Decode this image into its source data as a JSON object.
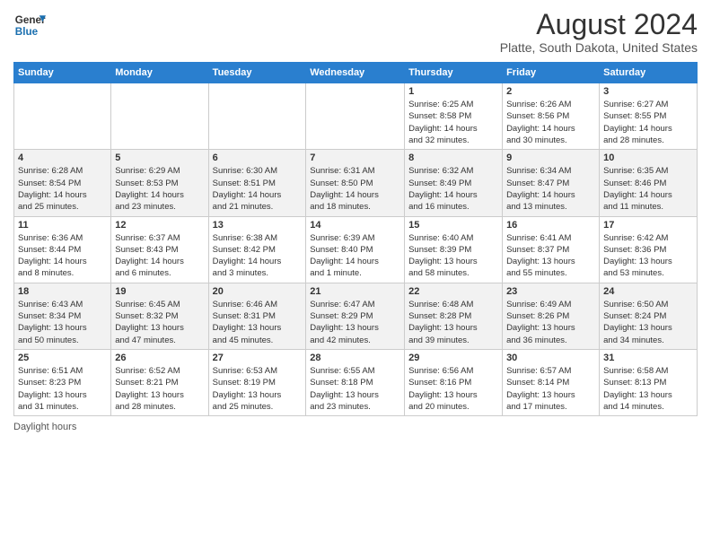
{
  "header": {
    "logo_line1": "General",
    "logo_line2": "Blue",
    "title": "August 2024",
    "subtitle": "Platte, South Dakota, United States"
  },
  "calendar": {
    "days_of_week": [
      "Sunday",
      "Monday",
      "Tuesday",
      "Wednesday",
      "Thursday",
      "Friday",
      "Saturday"
    ],
    "weeks": [
      [
        {
          "day": "",
          "info": ""
        },
        {
          "day": "",
          "info": ""
        },
        {
          "day": "",
          "info": ""
        },
        {
          "day": "",
          "info": ""
        },
        {
          "day": "1",
          "info": "Sunrise: 6:25 AM\nSunset: 8:58 PM\nDaylight: 14 hours\nand 32 minutes."
        },
        {
          "day": "2",
          "info": "Sunrise: 6:26 AM\nSunset: 8:56 PM\nDaylight: 14 hours\nand 30 minutes."
        },
        {
          "day": "3",
          "info": "Sunrise: 6:27 AM\nSunset: 8:55 PM\nDaylight: 14 hours\nand 28 minutes."
        }
      ],
      [
        {
          "day": "4",
          "info": "Sunrise: 6:28 AM\nSunset: 8:54 PM\nDaylight: 14 hours\nand 25 minutes."
        },
        {
          "day": "5",
          "info": "Sunrise: 6:29 AM\nSunset: 8:53 PM\nDaylight: 14 hours\nand 23 minutes."
        },
        {
          "day": "6",
          "info": "Sunrise: 6:30 AM\nSunset: 8:51 PM\nDaylight: 14 hours\nand 21 minutes."
        },
        {
          "day": "7",
          "info": "Sunrise: 6:31 AM\nSunset: 8:50 PM\nDaylight: 14 hours\nand 18 minutes."
        },
        {
          "day": "8",
          "info": "Sunrise: 6:32 AM\nSunset: 8:49 PM\nDaylight: 14 hours\nand 16 minutes."
        },
        {
          "day": "9",
          "info": "Sunrise: 6:34 AM\nSunset: 8:47 PM\nDaylight: 14 hours\nand 13 minutes."
        },
        {
          "day": "10",
          "info": "Sunrise: 6:35 AM\nSunset: 8:46 PM\nDaylight: 14 hours\nand 11 minutes."
        }
      ],
      [
        {
          "day": "11",
          "info": "Sunrise: 6:36 AM\nSunset: 8:44 PM\nDaylight: 14 hours\nand 8 minutes."
        },
        {
          "day": "12",
          "info": "Sunrise: 6:37 AM\nSunset: 8:43 PM\nDaylight: 14 hours\nand 6 minutes."
        },
        {
          "day": "13",
          "info": "Sunrise: 6:38 AM\nSunset: 8:42 PM\nDaylight: 14 hours\nand 3 minutes."
        },
        {
          "day": "14",
          "info": "Sunrise: 6:39 AM\nSunset: 8:40 PM\nDaylight: 14 hours\nand 1 minute."
        },
        {
          "day": "15",
          "info": "Sunrise: 6:40 AM\nSunset: 8:39 PM\nDaylight: 13 hours\nand 58 minutes."
        },
        {
          "day": "16",
          "info": "Sunrise: 6:41 AM\nSunset: 8:37 PM\nDaylight: 13 hours\nand 55 minutes."
        },
        {
          "day": "17",
          "info": "Sunrise: 6:42 AM\nSunset: 8:36 PM\nDaylight: 13 hours\nand 53 minutes."
        }
      ],
      [
        {
          "day": "18",
          "info": "Sunrise: 6:43 AM\nSunset: 8:34 PM\nDaylight: 13 hours\nand 50 minutes."
        },
        {
          "day": "19",
          "info": "Sunrise: 6:45 AM\nSunset: 8:32 PM\nDaylight: 13 hours\nand 47 minutes."
        },
        {
          "day": "20",
          "info": "Sunrise: 6:46 AM\nSunset: 8:31 PM\nDaylight: 13 hours\nand 45 minutes."
        },
        {
          "day": "21",
          "info": "Sunrise: 6:47 AM\nSunset: 8:29 PM\nDaylight: 13 hours\nand 42 minutes."
        },
        {
          "day": "22",
          "info": "Sunrise: 6:48 AM\nSunset: 8:28 PM\nDaylight: 13 hours\nand 39 minutes."
        },
        {
          "day": "23",
          "info": "Sunrise: 6:49 AM\nSunset: 8:26 PM\nDaylight: 13 hours\nand 36 minutes."
        },
        {
          "day": "24",
          "info": "Sunrise: 6:50 AM\nSunset: 8:24 PM\nDaylight: 13 hours\nand 34 minutes."
        }
      ],
      [
        {
          "day": "25",
          "info": "Sunrise: 6:51 AM\nSunset: 8:23 PM\nDaylight: 13 hours\nand 31 minutes."
        },
        {
          "day": "26",
          "info": "Sunrise: 6:52 AM\nSunset: 8:21 PM\nDaylight: 13 hours\nand 28 minutes."
        },
        {
          "day": "27",
          "info": "Sunrise: 6:53 AM\nSunset: 8:19 PM\nDaylight: 13 hours\nand 25 minutes."
        },
        {
          "day": "28",
          "info": "Sunrise: 6:55 AM\nSunset: 8:18 PM\nDaylight: 13 hours\nand 23 minutes."
        },
        {
          "day": "29",
          "info": "Sunrise: 6:56 AM\nSunset: 8:16 PM\nDaylight: 13 hours\nand 20 minutes."
        },
        {
          "day": "30",
          "info": "Sunrise: 6:57 AM\nSunset: 8:14 PM\nDaylight: 13 hours\nand 17 minutes."
        },
        {
          "day": "31",
          "info": "Sunrise: 6:58 AM\nSunset: 8:13 PM\nDaylight: 13 hours\nand 14 minutes."
        }
      ]
    ]
  },
  "footer": {
    "label": "Daylight hours"
  }
}
